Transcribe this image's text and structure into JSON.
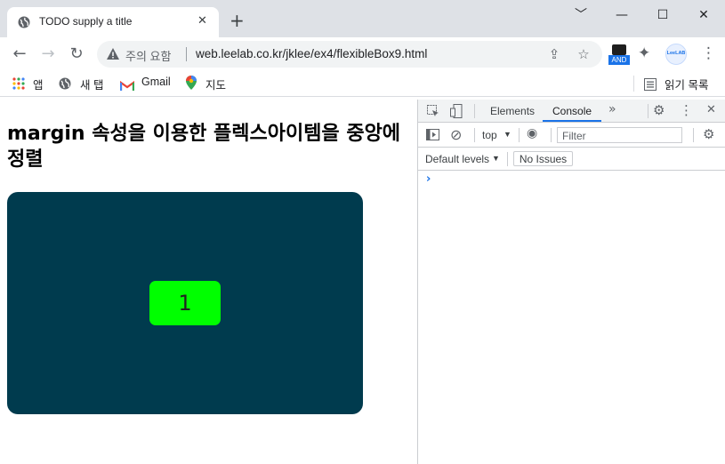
{
  "browser": {
    "tab_title": "TODO supply a title",
    "tab_close_glyph": "✕",
    "new_tab_glyph": "+",
    "window_controls": [
      "﹀",
      "—",
      "☐",
      "✕"
    ],
    "nav": {
      "back_glyph": "←",
      "forward_glyph": "→",
      "reload_glyph": "↻"
    },
    "omnibox": {
      "security_label": "주의 요함",
      "url": "web.leelab.co.kr/jklee/ex4/flexibleBox9.html",
      "share_glyph": "⇪",
      "star_glyph": "☆"
    },
    "extensions": {
      "ext1_badge": "AND",
      "ext2_label": "LeeLAB",
      "puzzle_glyph": "✦",
      "menu_glyph": "⋮"
    },
    "bookmarks": [
      {
        "label": "앱",
        "icon": "apps-grid-icon"
      },
      {
        "label": "새 탭",
        "icon": "globe-icon"
      },
      {
        "label": "Gmail",
        "icon": "gmail-icon"
      },
      {
        "label": "지도",
        "icon": "maps-pin-icon"
      }
    ],
    "reading_list_label": "읽기 목록",
    "colors": {
      "titlebar": "#dee1e6",
      "tab": "#ffffff",
      "accent": "#1a73e8"
    }
  },
  "page": {
    "heading": "margin 속성을 이용한 플렉스아이템을 중앙에 정렬",
    "flex_item_label": "1",
    "colors": {
      "container": "#003b4e",
      "item": "#00ff00"
    }
  },
  "devtools": {
    "tabs": [
      "Elements",
      "Console"
    ],
    "active_tab": "Console",
    "more_tabs_glyph": "»",
    "context": "top",
    "filter_placeholder": "Filter",
    "default_levels": "Default levels",
    "no_issues": "No Issues",
    "prompt_glyph": "›",
    "dropdown_glyph": "▼",
    "gear_glyph": "⚙",
    "kebab_glyph": "⋮",
    "close_glyph": "✕",
    "eye_glyph": "◉",
    "block_glyph": "⊘"
  }
}
